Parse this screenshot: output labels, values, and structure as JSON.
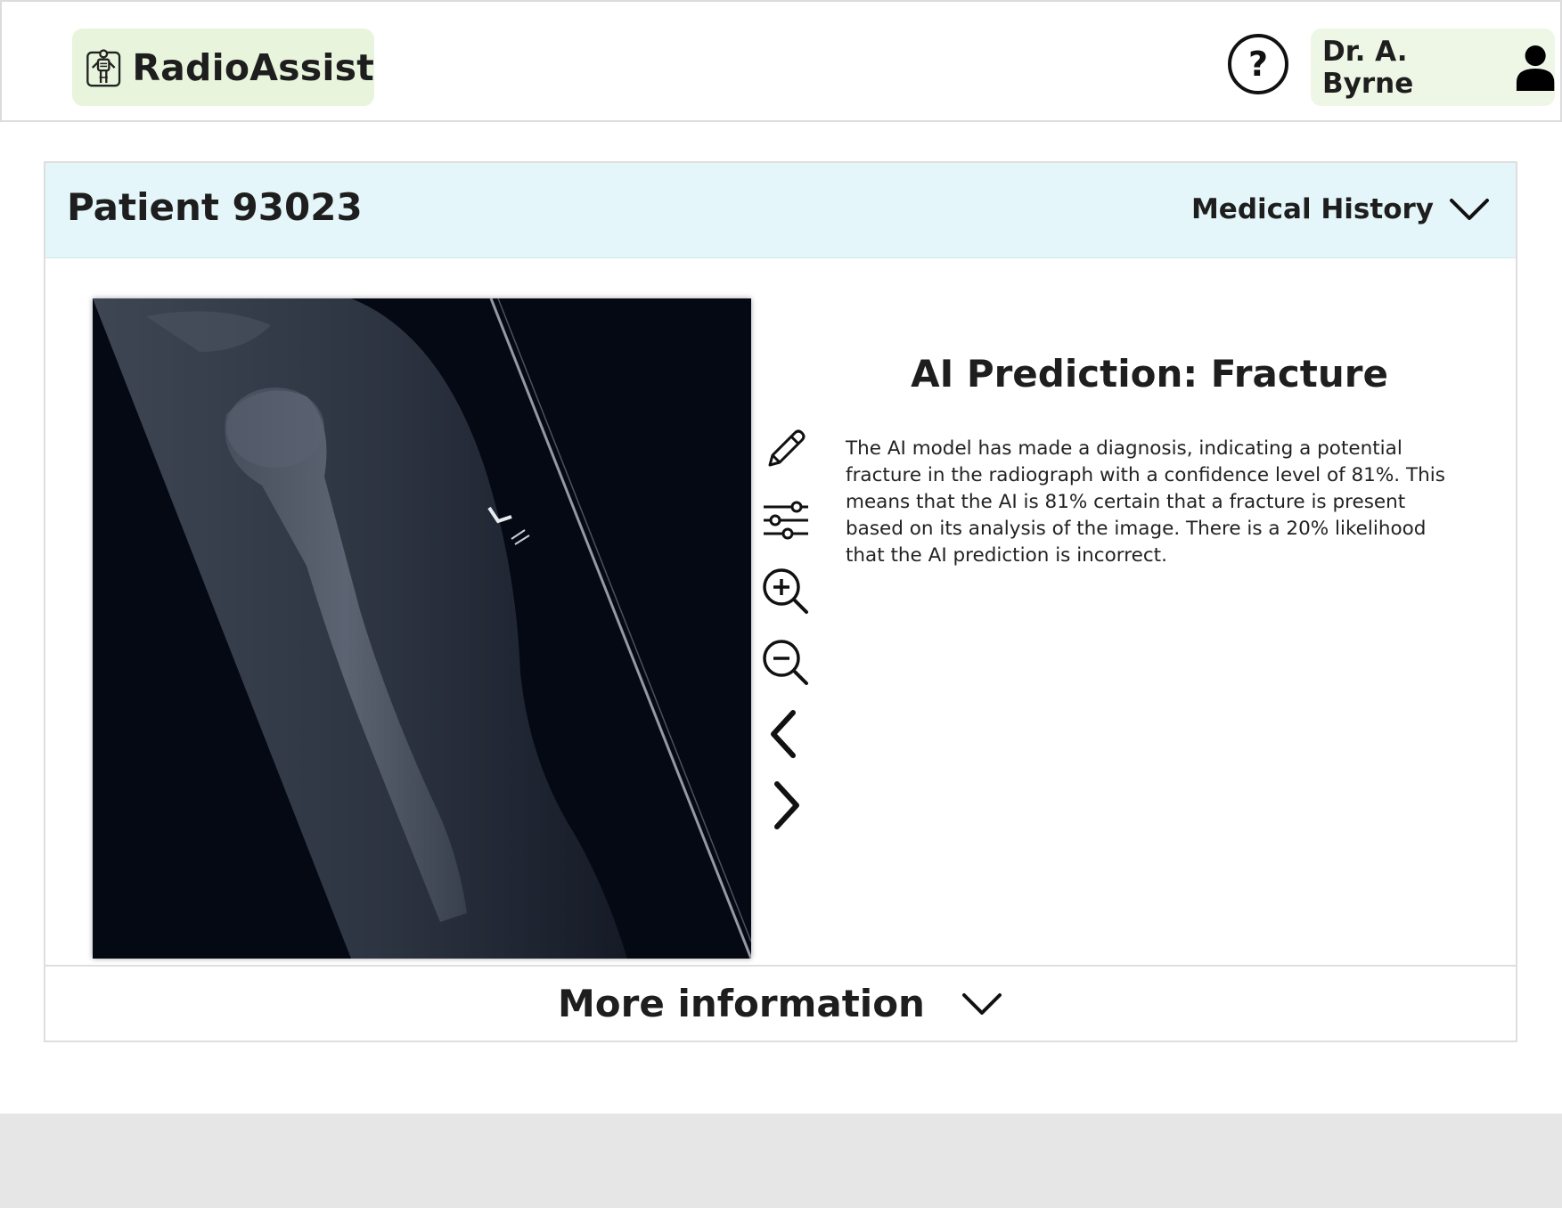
{
  "header": {
    "app_name": "RadioAssist",
    "help_symbol": "?",
    "user_name": "Dr. A. Byrne",
    "icons": {
      "logo": "x-ray-skeleton-icon",
      "help": "help-circle-icon",
      "user": "user-avatar-icon"
    }
  },
  "patient": {
    "title": "Patient 93023",
    "medical_history_label": "Medical History"
  },
  "prediction": {
    "title": "AI Prediction: Fracture",
    "description": "The AI model has made a diagnosis, indicating a potential fracture in the radiograph with a confidence level of 81%. This means that the AI is 81% certain that a fracture is present based on its analysis of the image. There is a 20% likelihood that the AI prediction is incorrect."
  },
  "toolbar": {
    "tools": [
      "pencil-icon",
      "sliders-icon",
      "zoom-in-icon",
      "zoom-out-icon",
      "chevron-left-icon",
      "chevron-right-icon"
    ]
  },
  "footer": {
    "more_label": "More information"
  },
  "colors": {
    "brand_bg": "#e8f5dc",
    "user_bg": "#eef6e6",
    "card_header_bg": "#e4f6f9",
    "footer_band": "#e5e6e5",
    "xray_bg": "#050913"
  }
}
